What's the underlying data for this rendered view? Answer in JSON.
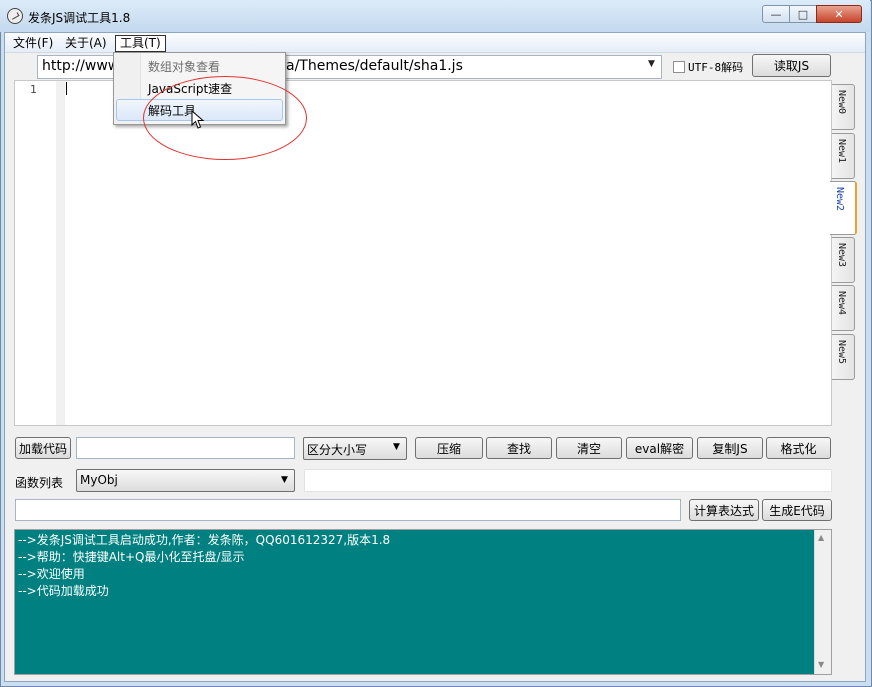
{
  "window": {
    "title": "发条JS调试工具1.8",
    "controls": {
      "minimize": "—",
      "maximize": "□",
      "close": "✕"
    }
  },
  "menubar": {
    "file": "文件(F)",
    "about": "关于(A)",
    "tools": "工具(T)"
  },
  "tools_menu": {
    "items": [
      {
        "label": "数组对象查看",
        "state": "disabled"
      },
      {
        "label": "JavaScript速查",
        "state": "normal"
      },
      {
        "label": "解码工具",
        "state": "hover"
      }
    ]
  },
  "url_bar": {
    "value_start": "http://www",
    "value_end": "a/Themes/default/sha1.js",
    "dropdown_arrow": "▼",
    "utf8_label": "UTF-8解码",
    "utf8_checked": false,
    "read_button": "读取JS"
  },
  "editor": {
    "line_numbers": [
      "1"
    ]
  },
  "tabs": {
    "items": [
      "New0",
      "New1",
      "New2",
      "New3",
      "New4",
      "New5"
    ],
    "active_index": 2
  },
  "toolbar": {
    "load_code": "加载代码",
    "load_input": "",
    "case_option": "区分大小写",
    "compress": "压缩",
    "find": "查找",
    "clear": "清空",
    "eval_decode": "eval解密",
    "copy_js": "复制JS",
    "format": "格式化"
  },
  "functions": {
    "label": "函数列表",
    "selected": "MyObj"
  },
  "expression": {
    "input": "",
    "calc": "计算表达式",
    "generate": "生成E代码"
  },
  "log": {
    "lines": [
      "-->发条JS调试工具启动成功,作者：发条陈，QQ601612327,版本1.8",
      "-->帮助：快捷键Alt+Q最小化至托盘/显示",
      "-->欢迎使用",
      "-->代码加载成功"
    ],
    "background": "#008080"
  },
  "colors": {
    "annotation_oval": "#e0332f",
    "active_tab_accent": "#f0a030"
  }
}
